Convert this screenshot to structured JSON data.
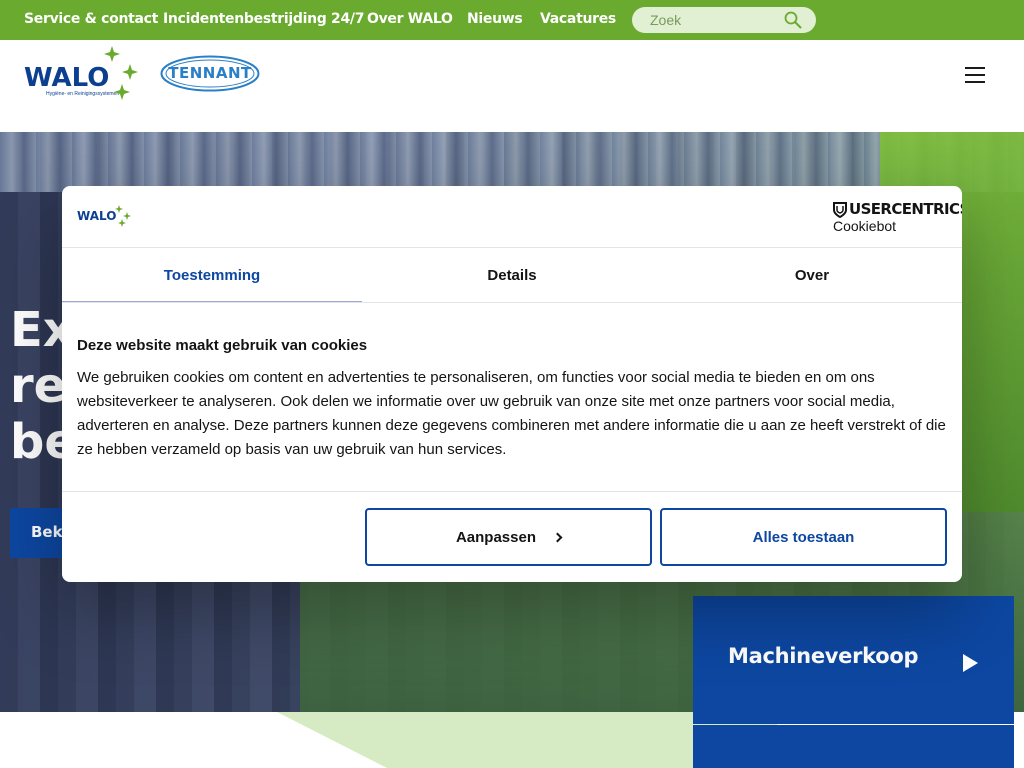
{
  "topnav": {
    "items": [
      {
        "label": "Service & contact"
      },
      {
        "label": "Incidentenbestrijding 24/7"
      },
      {
        "label": "Over WALO"
      },
      {
        "label": "Nieuws"
      },
      {
        "label": "Vacatures"
      }
    ],
    "search": {
      "placeholder": "Zoek"
    }
  },
  "header": {
    "logo_walo": "WALO",
    "logo_walo_tagline": "Hygiëne- en Reinigingssystemen",
    "logo_tennant": "TENNANT"
  },
  "hero": {
    "title_lines": [
      "Ex",
      "rei",
      "be"
    ],
    "cta_label": "Beki"
  },
  "tiles": {
    "machineverkoop": "Machineverkoop"
  },
  "cookie": {
    "logo": "WALO",
    "provider": "USERCENTRICS",
    "provider_sub": "Cookiebot",
    "tabs": [
      {
        "label": "Toestemming",
        "active": true
      },
      {
        "label": "Details",
        "active": false
      },
      {
        "label": "Over",
        "active": false
      }
    ],
    "title": "Deze website maakt gebruik van cookies",
    "body": "We gebruiken cookies om content en advertenties te personaliseren, om functies voor social media te bieden en om ons websiteverkeer te analyseren. Ook delen we informatie over uw gebruik van onze site met onze partners voor social media, adverteren en analyse. Deze partners kunnen deze gegevens combineren met andere informatie die u aan ze heeft verstrekt of die ze hebben verzameld op basis van uw gebruik van hun services.",
    "customize_label": "Aanpassen",
    "allow_all_label": "Alles toestaan"
  },
  "colors": {
    "brand_green": "#6aaa2e",
    "brand_blue": "#0d47a1"
  }
}
